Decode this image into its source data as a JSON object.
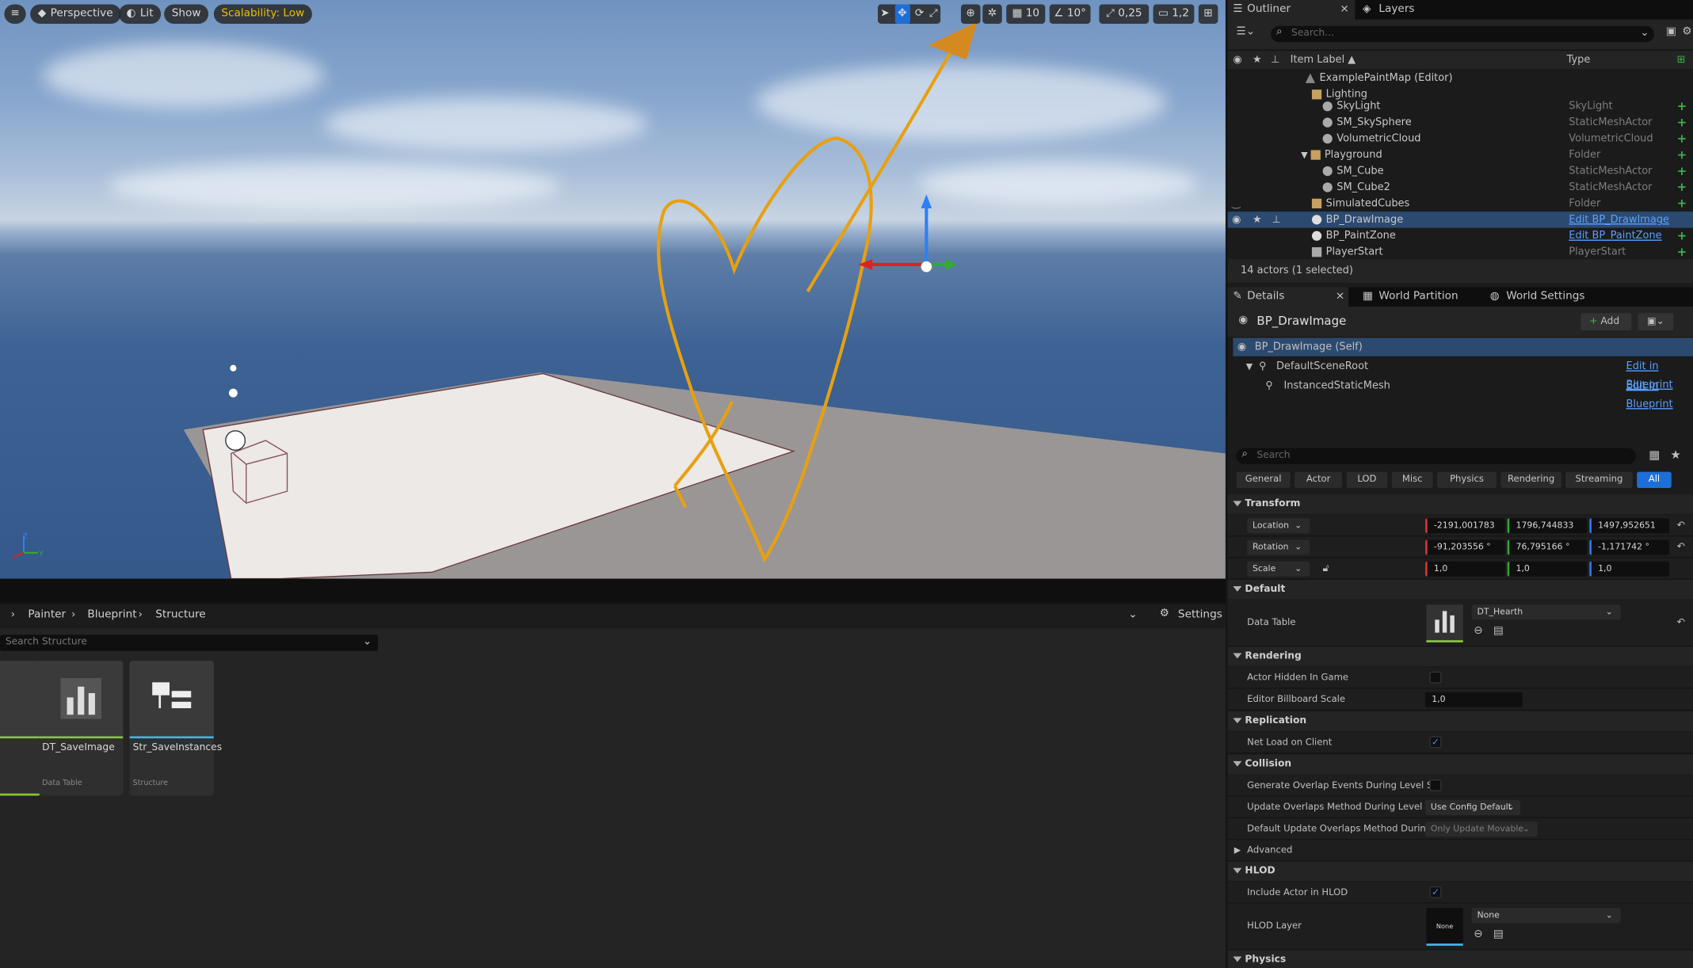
{
  "viewport": {
    "menu_icon": "hamburger-icon",
    "perspective_label": "Perspective",
    "lit_label": "Lit",
    "show_label": "Show",
    "scalability_label": "Scalability: Low",
    "grid_snap_value": "10",
    "rotation_snap_value": "10°",
    "scale_snap_value": "0,25",
    "camera_speed_value": "1,2",
    "axis_labels": {
      "z": "Z",
      "y": "Y"
    }
  },
  "content_browser": {
    "breadcrumbs": [
      "Painter",
      "Blueprint",
      "Structure"
    ],
    "settings_label": "Settings",
    "search_placeholder": "Search Structure",
    "assets": [
      {
        "name": "DT_SaveImage",
        "type": "Data Table",
        "accent": "#8ac43f"
      },
      {
        "name": "Str_SaveInstances",
        "type": "Structure",
        "accent": "#41b6e6"
      }
    ]
  },
  "outliner": {
    "tab_label": "Outliner",
    "layers_tab_label": "Layers",
    "search_placeholder": "Search...",
    "col_item_label": "Item Label ▲",
    "col_type": "Type",
    "items": [
      {
        "label": "ExamplePaintMap (Editor)",
        "type": "",
        "indent": 0
      },
      {
        "label": "Lighting",
        "type": "",
        "indent": 1
      },
      {
        "label": "SkyLight",
        "type": "SkyLight",
        "indent": 2
      },
      {
        "label": "SM_SkySphere",
        "type": "StaticMeshActor",
        "indent": 2
      },
      {
        "label": "VolumetricCloud",
        "type": "VolumetricCloud",
        "indent": 2
      },
      {
        "label": "Playground",
        "type": "Folder",
        "indent": 1
      },
      {
        "label": "SM_Cube",
        "type": "StaticMeshActor",
        "indent": 2
      },
      {
        "label": "SM_Cube2",
        "type": "StaticMeshActor",
        "indent": 2
      },
      {
        "label": "SimulatedCubes",
        "type": "Folder",
        "indent": 1
      },
      {
        "label": "BP_DrawImage",
        "type": "Edit BP_DrawImage",
        "indent": 1
      },
      {
        "label": "BP_PaintZone",
        "type": "Edit BP_PaintZone",
        "indent": 1
      },
      {
        "label": "PlayerStart",
        "type": "PlayerStart",
        "indent": 1
      }
    ],
    "status": "14 actors (1 selected)"
  },
  "details": {
    "tab_label": "Details",
    "world_partition_label": "World Partition",
    "world_settings_label": "World Settings",
    "actor_name": "BP_DrawImage",
    "add_label": "Add",
    "components": [
      {
        "label": "BP_DrawImage (Self)",
        "link": ""
      },
      {
        "label": "DefaultSceneRoot",
        "link": "Edit in Blueprint"
      },
      {
        "label": "InstancedStaticMesh",
        "link": "Edit in Blueprint"
      }
    ],
    "search_placeholder": "Search",
    "filters": [
      "General",
      "Actor",
      "LOD",
      "Misc",
      "Physics",
      "Rendering",
      "Streaming",
      "All"
    ],
    "transform": {
      "section": "Transform",
      "location_label": "Location",
      "location": [
        "-2191,001783",
        "1796,744833",
        "1497,952651"
      ],
      "rotation_label": "Rotation",
      "rotation": [
        "-91,203556 °",
        "76,795166 °",
        "-1,171742 °"
      ],
      "scale_label": "Scale",
      "scale": [
        "1,0",
        "1,0",
        "1,0"
      ]
    },
    "default_section": "Default",
    "data_table_label": "Data Table",
    "data_table_value": "DT_Hearth",
    "rendering_section": "Rendering",
    "actor_hidden_label": "Actor Hidden In Game",
    "billboard_scale_label": "Editor Billboard Scale",
    "billboard_scale_value": "1,0",
    "replication_section": "Replication",
    "net_load_label": "Net Load on Client",
    "collision_section": "Collision",
    "gen_overlap_label": "Generate Overlap Events During Level S...",
    "update_overlap_label": "Update Overlaps Method During Level S...",
    "update_overlap_value": "Use Config Default",
    "default_update_label": "Default Update Overlaps Method During...",
    "default_update_value": "Only Update Movable",
    "advanced_label": "Advanced",
    "hlod_section": "HLOD",
    "include_hlod_label": "Include Actor in HLOD",
    "hlod_layer_label": "HLOD Layer",
    "hlod_layer_thumb": "None",
    "hlod_layer_value": "None",
    "physics_section": "Physics"
  }
}
